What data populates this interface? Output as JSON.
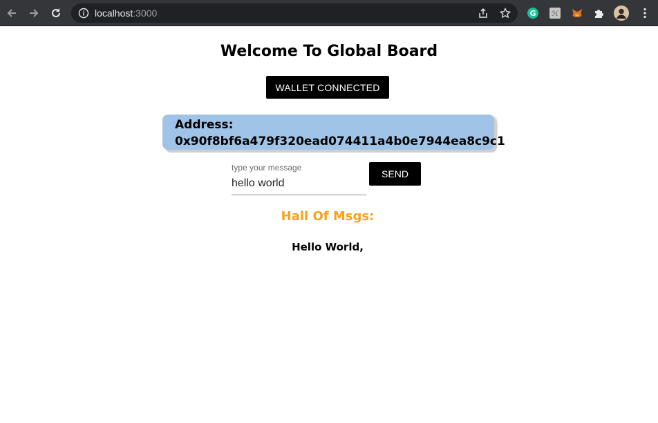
{
  "browser": {
    "url_host": "localhost",
    "url_port": ":3000",
    "icons": [
      "back-icon",
      "forward-icon",
      "reload-icon",
      "info-icon",
      "share-icon",
      "star-icon",
      "grammarly-icon",
      "extension-h-icon",
      "metamask-icon",
      "puzzle-icon",
      "profile-avatar",
      "menu-icon"
    ],
    "colors": {
      "chrome_bg": "#35363a",
      "omnibox_bg": "#202124"
    }
  },
  "page": {
    "title": "Welcome To Global Board",
    "wallet_button": "WALLET CONNECTED",
    "address_label": "Address:",
    "address_value": "0x90f8bf6a479f320ead074411a4b0e7944ea8c9c1",
    "message_field": {
      "label": "type your message",
      "value": "hello world"
    },
    "send_button": "SEND",
    "hall_heading": "Hall Of Msgs:",
    "messages": [
      "Hello World,"
    ],
    "colors": {
      "address_bg": "#a0c4e8",
      "heading_accent": "#f5a31a",
      "button_bg": "#000000"
    }
  }
}
